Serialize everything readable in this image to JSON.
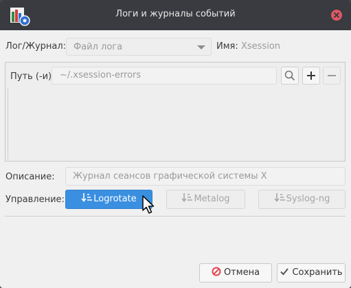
{
  "window": {
    "title": "Логи и журналы событий"
  },
  "log": {
    "label": "Лог/Журнал:",
    "combo_value": "Файл лога",
    "name_label": "Имя:",
    "name_value": "Xsession"
  },
  "path": {
    "label": "Путь (-и):",
    "value": "~/.xsession-errors"
  },
  "description": {
    "label": "Описание:",
    "placeholder": "Журнал сеансов графической системы X"
  },
  "management": {
    "label": "Управление:",
    "buttons": [
      {
        "label": "Logrotate",
        "state": "selected"
      },
      {
        "label": "Metalog",
        "state": "disabled"
      },
      {
        "label": "Syslog-ng",
        "state": "disabled"
      }
    ]
  },
  "footer": {
    "cancel_label": "Отмена",
    "save_label": "Сохранить"
  },
  "colors": {
    "titlebar": "#393b40",
    "accent": "#3a8fe0",
    "close": "#e15866",
    "cancel_icon": "#e0464f"
  }
}
